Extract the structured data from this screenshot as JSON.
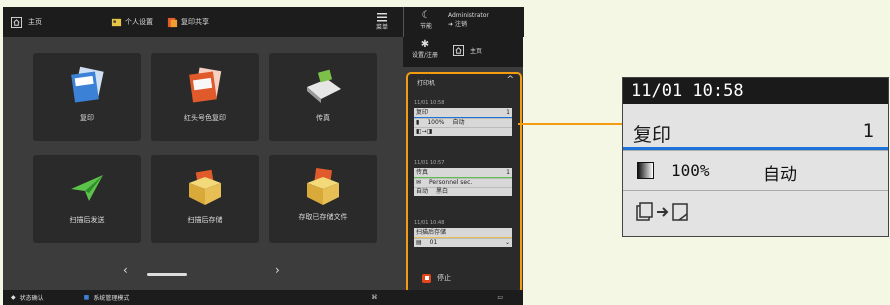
{
  "header": {
    "home_label": "主页",
    "shortcut1_label": "个人设置",
    "shortcut2_label": "复印共享"
  },
  "menu": {
    "label": "菜单"
  },
  "energy": {
    "label": "节能"
  },
  "user": {
    "name": "Administrator",
    "logout_label": "注销"
  },
  "settings": {
    "label": "设置/注册"
  },
  "home_button": {
    "label": "主页"
  },
  "tiles": [
    {
      "label": "复印",
      "icon": "copy-icon"
    },
    {
      "label": "红头号色复印",
      "icon": "color-copy-icon"
    },
    {
      "label": "传真",
      "icon": "fax-icon"
    },
    {
      "label": "扫描后发送",
      "icon": "scan-send-icon"
    },
    {
      "label": "扫描后存储",
      "icon": "scan-store-icon"
    },
    {
      "label": "存取已存储文件",
      "icon": "stored-files-icon"
    }
  ],
  "pager": {
    "prev": "‹",
    "next": "›"
  },
  "bottom": {
    "status_label": "状态确认",
    "mode_label": "系统管理模式"
  },
  "monitor": {
    "title": "打印机",
    "collapse": "^",
    "jobs": [
      {
        "time": "11/01 10:58",
        "name": "复印",
        "count": "1",
        "ratio": "100%",
        "paper": "自动"
      },
      {
        "time": "11/01 10:57",
        "name": "传真",
        "count": "1",
        "sender": "Personnel sec.",
        "row2a": "自动",
        "row2b": "黑白"
      },
      {
        "time": "11/01 10:48",
        "name": "扫描后存储",
        "row1": "01"
      }
    ],
    "stop_label": "停止"
  },
  "zoom": {
    "time": "11/01 10:58",
    "job_name": "复印",
    "count": "1",
    "ratio": "100%",
    "paper": "自动"
  },
  "colors": {
    "accent": "#f39c12",
    "job_line": "#1e73d8",
    "stop": "#e3461b"
  }
}
